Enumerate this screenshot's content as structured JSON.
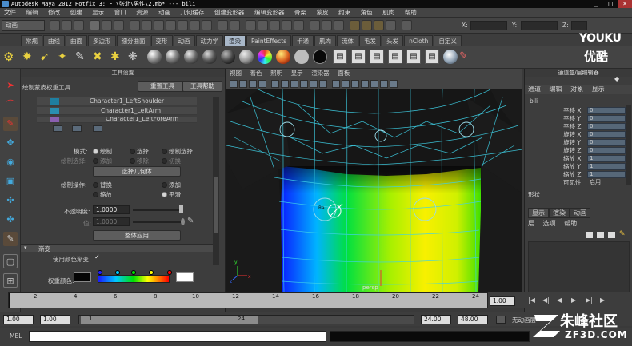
{
  "window": {
    "title": "Autodesk Maya 2012 Hotfix 3: F:\\张北\\男性\\2.mb*   ---   bili",
    "controls": [
      "_",
      "□",
      "×"
    ]
  },
  "menubar": [
    "文件",
    "编辑",
    "修改",
    "创建",
    "显示",
    "窗口",
    "资源",
    "动画",
    "几何缓存",
    "创建变形器",
    "编辑变形器",
    "骨架",
    "蒙皮",
    "约束",
    "角色",
    "肌肉",
    "帮助"
  ],
  "status": {
    "mode": "动画",
    "x_label": "X:",
    "y_label": "Y:",
    "z_label": "Z:"
  },
  "shelf_tabs": [
    {
      "label": "常规"
    },
    {
      "label": "曲线"
    },
    {
      "label": "曲面"
    },
    {
      "label": "多边形"
    },
    {
      "label": "细分曲面"
    },
    {
      "label": "变形"
    },
    {
      "label": "动画"
    },
    {
      "label": "动力学"
    },
    {
      "label": "渲染",
      "active": true
    },
    {
      "label": "PaintEffects"
    },
    {
      "label": "卡通"
    },
    {
      "label": "肌肉"
    },
    {
      "label": "流体"
    },
    {
      "label": "毛发"
    },
    {
      "label": "头发"
    },
    {
      "label": "nCloth"
    },
    {
      "label": "自定义"
    }
  ],
  "tool_settings": {
    "panel_title": "工具设置",
    "tool_name": "绘制蒙皮权重工具",
    "reset_button": "重置工具",
    "help_button": "工具帮助",
    "influences": [
      {
        "name": "Character1_LeftShoulder",
        "color": "#1f7fa0"
      },
      {
        "name": "Character1_LeftArm",
        "color": "#2a8fb0"
      },
      {
        "name": "Character1_LeftForeArm",
        "color": "#8a5fb0"
      }
    ],
    "mode_label": "模式:",
    "mode_options": [
      "绘制",
      "选择",
      "绘制选择"
    ],
    "paint_select_label": "绘制选择:",
    "paint_select_options": [
      "添加",
      "移除",
      "切换"
    ],
    "select_geometry_button": "选择几何体",
    "paint_op_label": "绘制操作:",
    "paint_ops_row1": [
      "替换",
      "添加"
    ],
    "paint_ops_row2": [
      "缩放",
      "平滑"
    ],
    "opacity_label": "不透明度:",
    "opacity_value": "1.0000",
    "value_label": "值:",
    "value_value": "1.0000",
    "flood_button": "整体应用",
    "gradient_section": "渐变",
    "use_color_ramp_label": "使用颜色渐变",
    "weight_color_label": "权重颜色:"
  },
  "viewport": {
    "menu": [
      "视图",
      "着色",
      "照明",
      "显示",
      "渲染器",
      "面板"
    ],
    "camera_label": "persp"
  },
  "channel_box": {
    "header": "通道盒/层编辑器",
    "menu": [
      "通道",
      "编辑",
      "对象",
      "显示"
    ],
    "object": "bili",
    "channels": [
      {
        "name": "平移 X",
        "value": "0"
      },
      {
        "name": "平移 Y",
        "value": "0"
      },
      {
        "name": "平移 Z",
        "value": "0"
      },
      {
        "name": "旋转 X",
        "value": "0"
      },
      {
        "name": "旋转 Y",
        "value": "0"
      },
      {
        "name": "旋转 Z",
        "value": "0"
      },
      {
        "name": "缩放 X",
        "value": "1"
      },
      {
        "name": "缩放 Y",
        "value": "1"
      },
      {
        "name": "缩放 Z",
        "value": "1"
      },
      {
        "name": "可见性",
        "value": "启用"
      }
    ],
    "shapes_label": "形状",
    "layer_tabs": [
      "显示",
      "渲染",
      "动画"
    ],
    "layer_menu": [
      "层",
      "选项",
      "帮助"
    ]
  },
  "timeline": {
    "ticks": [
      "2",
      "4",
      "6",
      "8",
      "10",
      "12",
      "14",
      "16",
      "18",
      "20",
      "22",
      "24"
    ],
    "current_frame": "1.00",
    "buttons": [
      "|◀",
      "◀|",
      "◀",
      "▶",
      "▶|",
      "▶|"
    ]
  },
  "range": {
    "start": "1.00",
    "playback_start": "1.00",
    "slider_start": "1",
    "slider_end": "24",
    "playback_end": "24.00",
    "end": "48.00",
    "char_set": "无动画层"
  },
  "command": {
    "label": "MEL"
  },
  "watermarks": {
    "youku_en": "YOUKU",
    "youku_cn": "优酷",
    "zf3d_cn": "朱峰社区",
    "zf3d_en": "ZF3D.COM"
  }
}
